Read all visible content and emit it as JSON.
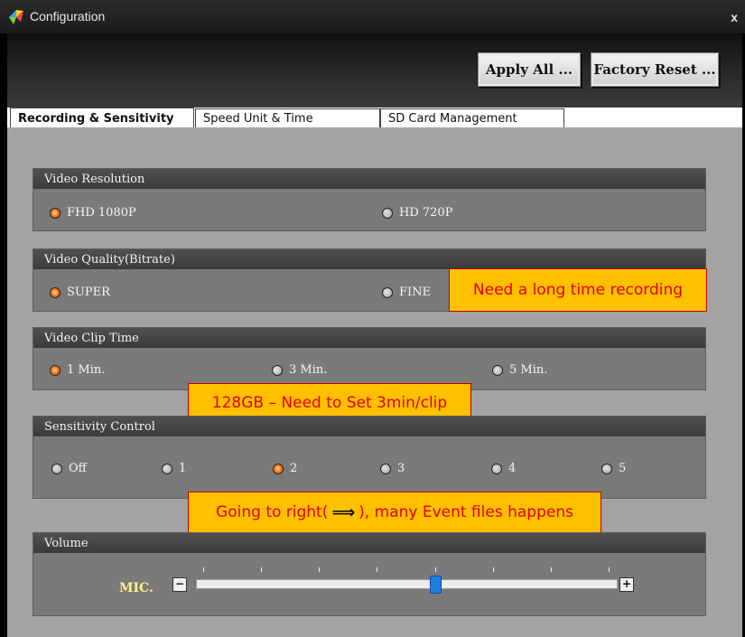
{
  "window": {
    "title": "Configuration",
    "close_label": "x"
  },
  "toolbar": {
    "apply_all_label": "Apply All ...",
    "factory_reset_label": "Factory Reset ..."
  },
  "tabs": [
    {
      "label": "Recording & Sensitivity",
      "active": true
    },
    {
      "label": "Speed Unit & Time",
      "active": false
    },
    {
      "label": "SD Card Management",
      "active": false
    }
  ],
  "groups": {
    "video_resolution": {
      "title": "Video Resolution",
      "options": [
        "FHD 1080P",
        "HD 720P"
      ],
      "selected": "FHD 1080P"
    },
    "video_quality": {
      "title": "Video Quality(Bitrate)",
      "options": [
        "SUPER",
        "FINE"
      ],
      "selected": "SUPER"
    },
    "clip_time": {
      "title": "Video Clip Time",
      "options": [
        "1 Min.",
        "3 Min.",
        "5 Min."
      ],
      "selected": "1 Min."
    },
    "sensitivity": {
      "title": "Sensitivity Control",
      "options": [
        "Off",
        "1",
        "2",
        "3",
        "4",
        "5"
      ],
      "selected": "2"
    },
    "volume": {
      "title": "Volume",
      "mic_label": "MIC.",
      "minus": "−",
      "plus": "+",
      "level_fraction": 0.57,
      "ticks": 8
    }
  },
  "notes": {
    "long_recording": "Need a long time recording",
    "clip_128gb": "128GB – Need to Set 3min/clip",
    "going_right_prefix": "Going to right(",
    "going_right_arrow": "⟹",
    "going_right_suffix": "), many Event files happens"
  },
  "colors": {
    "annotation_fill": "#ffc000",
    "annotation_text": "#e00000",
    "radio_selected": "#ff7a1a",
    "slider_thumb": "#1f7fe0"
  }
}
